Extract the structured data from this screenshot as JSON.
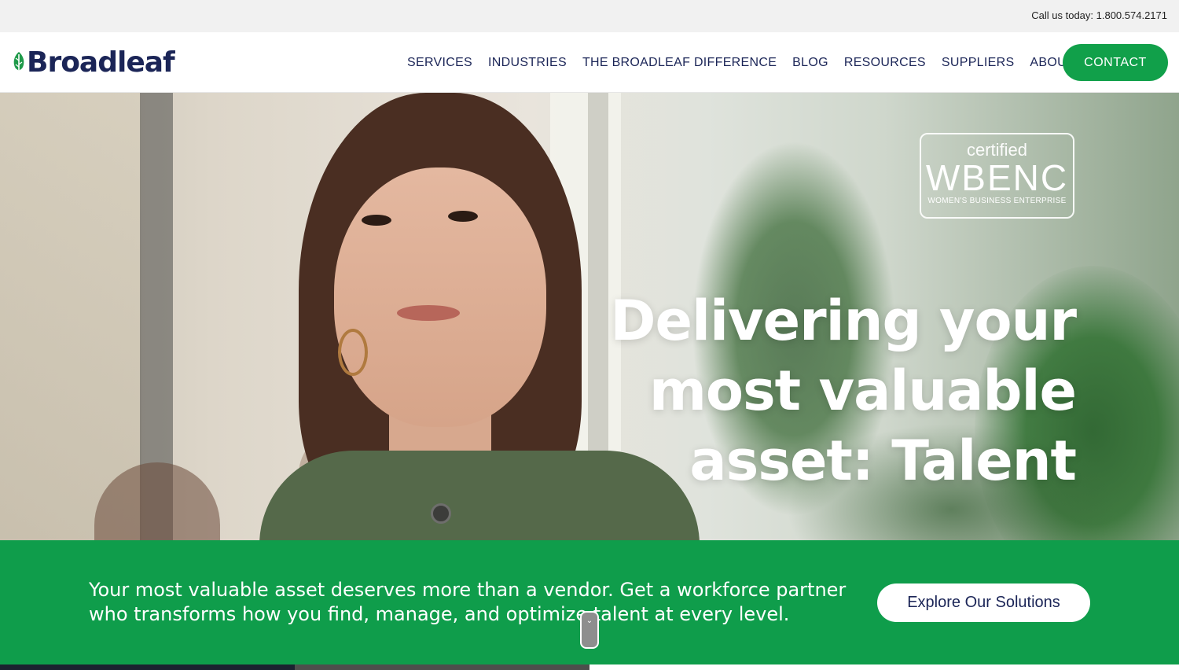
{
  "topbar": {
    "phone_text": "Call us today: 1.800.574.2171"
  },
  "header": {
    "logo_text": "Broadleaf",
    "nav": [
      {
        "label": "SERVICES"
      },
      {
        "label": "INDUSTRIES"
      },
      {
        "label": "THE BROADLEAF DIFFERENCE"
      },
      {
        "label": "BLOG"
      },
      {
        "label": "RESOURCES"
      },
      {
        "label": "SUPPLIERS"
      },
      {
        "label": "ABOUT"
      }
    ],
    "contact_label": "CONTACT"
  },
  "hero": {
    "badge": {
      "certified": "certified",
      "wbenc": "WBENC",
      "subtitle": "WOMEN'S BUSINESS ENTERPRISE"
    },
    "headline_line1": "Delivering your",
    "headline_line2": "most valuable",
    "headline_line3": "asset: Talent"
  },
  "band": {
    "line1": "Your most valuable asset deserves more than a vendor. Get a workforce partner",
    "line2": "who transforms how you find, manage, and optimize talent at every level.",
    "cta_label": "Explore Our Solutions"
  },
  "colors": {
    "brand_green": "#0f9d4b",
    "brand_navy": "#1b2557",
    "topbar_bg": "#f1f1f1"
  },
  "icons": {
    "logo_mark": "leaf-icon",
    "scroll": "chevron-down-icon"
  }
}
